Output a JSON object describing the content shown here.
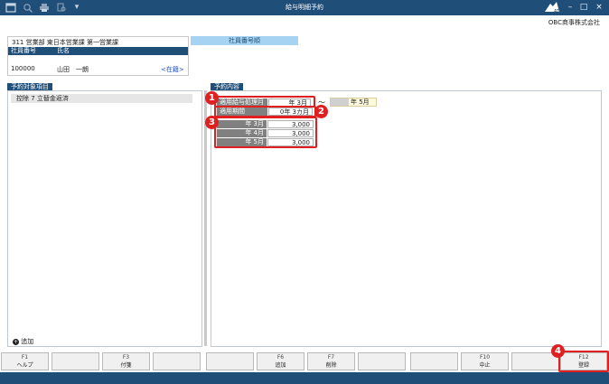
{
  "window": {
    "title": "給与明細予約",
    "toolbar_icons": [
      "window-icon",
      "search-icon",
      "print-icon",
      "preview-icon",
      "dropdown-icon"
    ],
    "controls": {
      "minimize": "–",
      "maximize": "□",
      "close": "×"
    }
  },
  "company": "OBC商事株式会社",
  "employee": {
    "department": "311 営業部 東日本営業課 第一営業課",
    "col_number": "社員番号",
    "col_name": "氏名",
    "number": "100000",
    "name": "山田　一朗",
    "status": "<在籍>"
  },
  "employee_number_label": "社員番号順",
  "left_panel": {
    "title": "予約対象項目",
    "items": [
      "控除 7  立替金返済"
    ],
    "add_label": "追加"
  },
  "right_panel": {
    "title": "予約内容",
    "start_label": "適用給与処理月",
    "start_value": "年  3月",
    "tilde": "～",
    "end_value": "年  5月",
    "period_label": "適用期間",
    "period_value": "0年  3カ月",
    "months": [
      {
        "label": "年  3月",
        "value": "3,000"
      },
      {
        "label": "年  4月",
        "value": "3,000"
      },
      {
        "label": "年  5月",
        "value": "3,000"
      }
    ]
  },
  "badges": [
    "1",
    "2",
    "3",
    "4"
  ],
  "fkeys": [
    {
      "key": "F1",
      "label": "ヘルプ"
    },
    {
      "key": "",
      "label": ""
    },
    {
      "key": "F3",
      "label": "付箋"
    },
    {
      "key": "",
      "label": ""
    },
    {
      "key": "",
      "label": ""
    },
    {
      "key": "F6",
      "label": "追加"
    },
    {
      "key": "F7",
      "label": "削除"
    },
    {
      "key": "",
      "label": ""
    },
    {
      "key": "",
      "label": ""
    },
    {
      "key": "F10",
      "label": "中止"
    },
    {
      "key": "",
      "label": ""
    },
    {
      "key": "F12",
      "label": "登録"
    }
  ],
  "colors": {
    "titlebar": "#1f4e79",
    "highlight": "#e02020",
    "accent_label": "#a7d3f2"
  }
}
